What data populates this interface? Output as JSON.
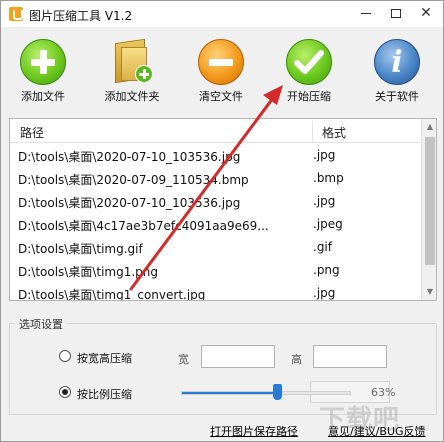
{
  "window": {
    "title": "图片压缩工具 V1.2"
  },
  "toolbar": {
    "add_file": "添加文件",
    "add_folder": "添加文件夹",
    "clear_files": "清空文件",
    "start_compress": "开始压缩",
    "about": "关于软件"
  },
  "file_list": {
    "headers": {
      "path": "路径",
      "format": "格式"
    },
    "rows": [
      {
        "path": "D:\\tools\\桌面\\2020-07-10_103536.jpg",
        "format": ".jpg"
      },
      {
        "path": "D:\\tools\\桌面\\2020-07-09_110534.bmp",
        "format": ".bmp"
      },
      {
        "path": "D:\\tools\\桌面\\2020-07-10_103536.jpg",
        "format": ".jpg"
      },
      {
        "path": "D:\\tools\\桌面\\4c17ae3b7efc4091aa9e69...",
        "format": ".jpeg"
      },
      {
        "path": "D:\\tools\\桌面\\timg.gif",
        "format": ".gif"
      },
      {
        "path": "D:\\tools\\桌面\\timg1.png",
        "format": ".png"
      },
      {
        "path": "D:\\tools\\桌面\\timg1_convert.jpg",
        "format": ".jpg"
      }
    ]
  },
  "options": {
    "group_title": "选项设置",
    "by_size_label": "按宽高压缩",
    "width_label": "宽",
    "height_label": "高",
    "width_value": "",
    "height_value": "",
    "by_ratio_label": "按比例压缩",
    "ratio_percent": 63,
    "ratio_text": "63%"
  },
  "footer": {
    "open_folder_link": "打开图片保存路径",
    "feedback_link": "意见/建议/BUG反馈"
  },
  "overlay": {
    "watermark": "下载吧"
  },
  "colors": {
    "accent": "#2a7bd6",
    "annotation_arrow": "#d42a2a"
  }
}
